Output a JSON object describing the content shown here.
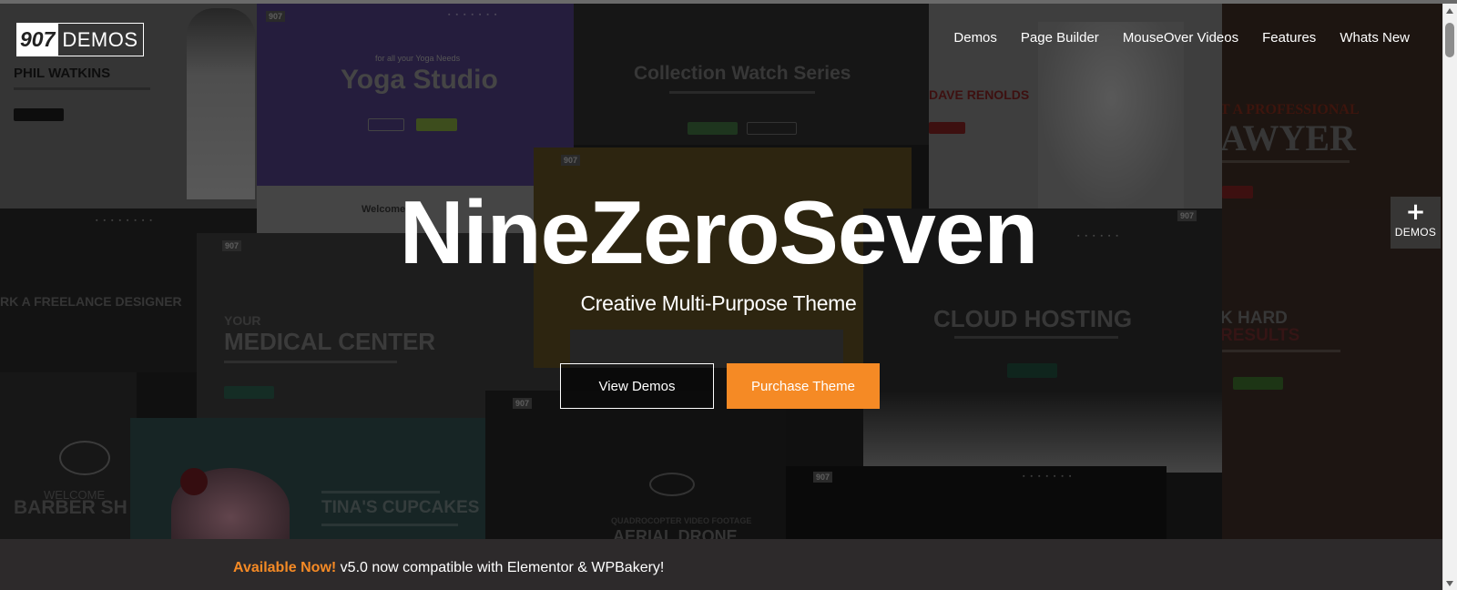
{
  "header": {
    "logo": {
      "number": "907",
      "word": "DEMOS"
    },
    "nav": [
      {
        "label": "Demos"
      },
      {
        "label": "Page Builder"
      },
      {
        "label": "MouseOver Videos"
      },
      {
        "label": "Features"
      },
      {
        "label": "Whats New"
      }
    ]
  },
  "hero": {
    "title": "NineZeroSeven",
    "subtitle": "Creative Multi-Purpose Theme",
    "view_demos_label": "View Demos",
    "purchase_label": "Purchase Theme"
  },
  "side_tab": {
    "icon": "plus-icon",
    "label": "DEMOS"
  },
  "banner": {
    "highlight": "Available Now!",
    "text": " v5.0 now compatible with Elementor & WPBakery!"
  },
  "background_tiles": {
    "phil_name": "PHIL WATKINS",
    "yoga_intro": "for all your Yoga Needs",
    "yoga_title": "Yoga Studio",
    "yoga_welcome": "Welcome to",
    "watch_title": "Collection Watch Series",
    "dave_name": "DAVE RENOLDS",
    "lawyer_pre": "T A PROFESSIONAL",
    "lawyer_title": "AWYER",
    "freelance": "RK A FREELANCE DESIGNER",
    "medical_pre": "YOUR",
    "medical_title": "MEDICAL CENTER",
    "cloud_title": "CLOUD HOSTING",
    "hard_title": "K HARD",
    "hard_sub": "RESULTS",
    "barber_welcome": "WELCOME",
    "barber_title": "BARBER SH",
    "cupcakes_title": "TINA'S CUPCAKES",
    "drone_pre": "QUADROCOPTER VIDEO FOOTAGE",
    "drone_title": "AERIAL DRONE"
  },
  "colors": {
    "accent": "#f58a25",
    "bar": "#2d2a2b"
  }
}
